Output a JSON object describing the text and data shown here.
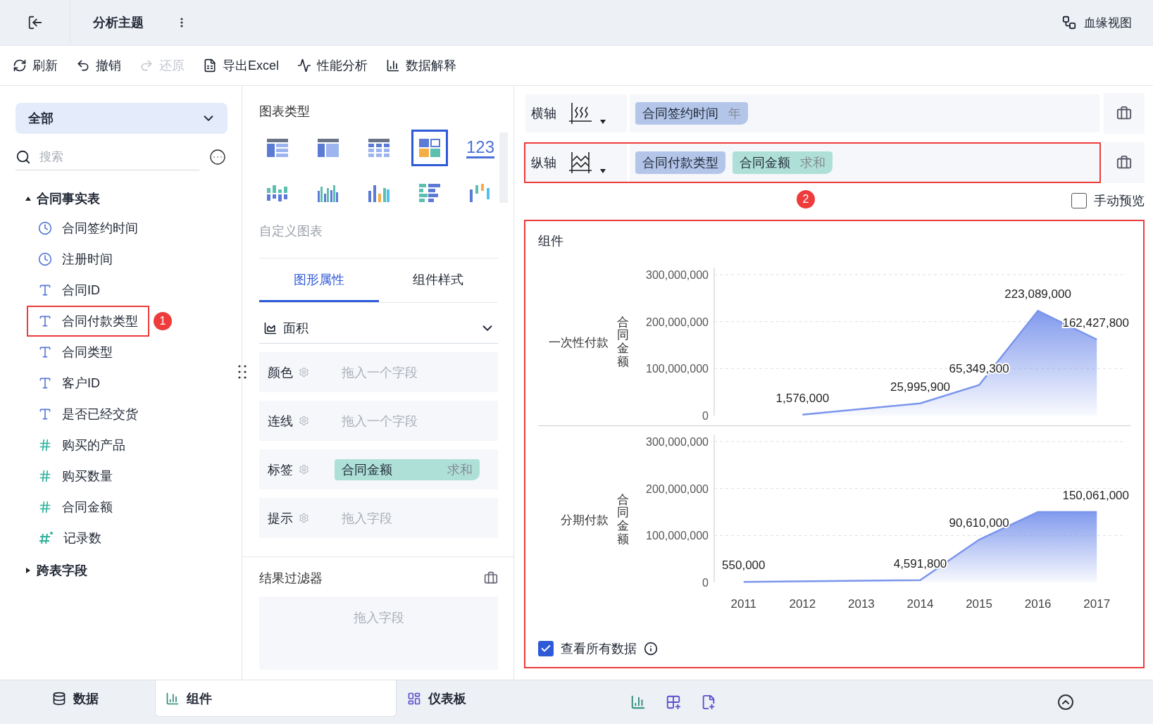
{
  "topbar": {
    "title": "分析主题",
    "lineage": "血缘视图"
  },
  "toolbar": [
    {
      "kind": "refresh",
      "label": "刷新",
      "disabled": false
    },
    {
      "kind": "undo",
      "label": "撤销",
      "disabled": false
    },
    {
      "kind": "redo",
      "label": "还原",
      "disabled": true
    },
    {
      "kind": "excel",
      "label": "导出Excel",
      "disabled": false
    },
    {
      "kind": "performance",
      "label": "性能分析",
      "disabled": false
    },
    {
      "kind": "explain",
      "label": "数据解释",
      "disabled": false
    }
  ],
  "fields": {
    "scope": "全部",
    "search": {
      "placeholder": "搜索"
    },
    "groups": [
      {
        "name": "合同事实表",
        "expanded": true,
        "children": [
          {
            "name": "合同签约时间",
            "kind": "date"
          },
          {
            "name": "注册时间",
            "kind": "date"
          },
          {
            "name": "合同ID",
            "kind": "text"
          },
          {
            "name": "合同付款类型",
            "kind": "text",
            "callout": "1"
          },
          {
            "name": "合同类型",
            "kind": "text"
          },
          {
            "name": "客户ID",
            "kind": "text"
          },
          {
            "name": "是否已经交货",
            "kind": "text"
          },
          {
            "name": "购买的产品",
            "kind": "number"
          },
          {
            "name": "购买数量",
            "kind": "number"
          },
          {
            "name": "合同金额",
            "kind": "number"
          },
          {
            "name": "记录数",
            "kind": "calculated"
          }
        ]
      },
      {
        "name": "跨表字段",
        "expanded": false
      }
    ]
  },
  "chart_types": {
    "title": "图表类型",
    "items": [
      {
        "kind": "detail-table",
        "selected": false
      },
      {
        "kind": "cross-table",
        "selected": false
      },
      {
        "kind": "grouped-table",
        "selected": false
      },
      {
        "kind": "card-grid",
        "selected": true
      },
      {
        "kind": "number",
        "text": "123",
        "selected": false
      },
      {
        "kind": "dot-bars",
        "selected": false
      },
      {
        "kind": "grouped-bars",
        "selected": false
      },
      {
        "kind": "colored-bars",
        "selected": false
      },
      {
        "kind": "bar-rows",
        "selected": false
      },
      {
        "kind": "range-bars",
        "selected": false
      }
    ],
    "custom": "自定义图表"
  },
  "property_tabs": [
    {
      "label": "图形属性",
      "selected": true
    },
    {
      "label": "组件样式",
      "selected": false
    }
  ],
  "mark_type": "面积",
  "slots": [
    {
      "label": "颜色",
      "placeholder": "拖入一个字段"
    },
    {
      "label": "连线",
      "placeholder": "拖入一个字段"
    },
    {
      "label": "标签",
      "pill": {
        "name": "合同金额",
        "agg": "求和"
      }
    },
    {
      "label": "提示",
      "placeholder": "拖入字段"
    }
  ],
  "filter": {
    "title": "结果过滤器",
    "placeholder": "拖入字段"
  },
  "axes": [
    {
      "label": "横轴",
      "kind": "x",
      "pills": [
        {
          "name": "合同签约时间",
          "agg": "年",
          "kind": "dimension"
        }
      ]
    },
    {
      "label": "纵轴",
      "kind": "y",
      "callout": "2",
      "pills": [
        {
          "name": "合同付款类型",
          "kind": "dimension"
        },
        {
          "name": "合同金额",
          "agg": "求和",
          "kind": "measure"
        }
      ]
    }
  ],
  "manual_preview": {
    "label": "手动预览",
    "checked": false
  },
  "component": {
    "title": "组件",
    "highlighted": true,
    "facets": [
      {
        "label": "一次性付款",
        "chart_data": {
          "type": "area",
          "ylabel": "合同金额",
          "ylim": [
            0,
            300000000
          ],
          "yticks": [
            {
              "value": 0,
              "label": "0"
            },
            {
              "value": 100000000,
              "label": "100,000,000"
            },
            {
              "value": 200000000,
              "label": "200,000,000"
            },
            {
              "value": 300000000,
              "label": "300,000,000"
            }
          ],
          "series": [
            {
              "color": "#7b95ec",
              "values": [
                null,
                2000000,
                null,
                26000000,
                65000000,
                223000000,
                162000000
              ]
            }
          ],
          "value_labels": [
            null,
            "1,576,000",
            null,
            "25,995,900",
            "65,349,300",
            "223,089,000",
            "162,427,800"
          ]
        }
      },
      {
        "label": "分期付款",
        "chart_data": {
          "type": "area",
          "ylabel": "合同金额",
          "categories": [
            "2011",
            "2012",
            "2013",
            "2014",
            "2015",
            "2016",
            "2017"
          ],
          "ylim": [
            0,
            300000000
          ],
          "yticks": [
            {
              "value": 0,
              "label": "0"
            },
            {
              "value": 100000000,
              "label": "100,000,000"
            },
            {
              "value": 200000000,
              "label": "200,000,000"
            },
            {
              "value": 300000000,
              "label": "300,000,000"
            }
          ],
          "series": [
            {
              "color": "#7b95ec",
              "values": [
                1000000,
                null,
                null,
                5000000,
                91000000,
                150000000,
                150000000
              ]
            }
          ],
          "value_labels": [
            "550,000",
            null,
            null,
            "4,591,800",
            "90,610,000",
            null,
            "150,061,000"
          ]
        }
      }
    ],
    "show_all": {
      "label": "查看所有数据",
      "checked": true
    }
  },
  "bottom_tabs": [
    {
      "kind": "data",
      "label": "数据",
      "selected": false
    },
    {
      "kind": "component",
      "label": "组件",
      "selected": true
    },
    {
      "kind": "dashboard",
      "label": "仪表板",
      "selected": false
    }
  ]
}
